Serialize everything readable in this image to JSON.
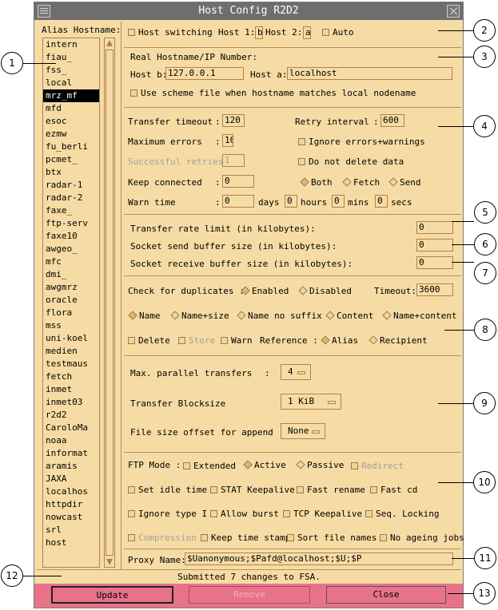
{
  "window": {
    "title": "Host Config R2D2"
  },
  "aliasList": {
    "label": "Alias Hostname:",
    "items": [
      "intern",
      "fiau_",
      "fss_",
      "local",
      "mrz_mf",
      "mfd",
      "esoc",
      "ezmw",
      "fu_berli",
      "pcmet_",
      "btx",
      "radar-1",
      "radar-2",
      "faxe_",
      "ftp-serv",
      "faxe10",
      "awgeo_",
      "mfc",
      "dmi_",
      "awgmrz",
      "oracle",
      "flora",
      "mss",
      "uni-koel",
      "medien",
      "testmaus",
      "fetch",
      "inmet",
      "inmet03",
      "r2d2",
      "CaroloMa",
      "noaa",
      "informat",
      "aramis",
      "JAXA",
      "localhos",
      "httpdir",
      "nowcast",
      "srl",
      "host"
    ],
    "selected": "mrz_mf"
  },
  "hostSwitch": {
    "label": "Host switching",
    "host1Label": "Host 1:",
    "host1": "b",
    "host2Label": "Host 2:",
    "host2": "a",
    "autoLabel": "Auto"
  },
  "realHost": {
    "label": "Real Hostname/IP Number:",
    "hostBLabel": "Host b:",
    "hostB": "127.0.0.1",
    "hostALabel": "Host a:",
    "hostA": "localhost",
    "schemeLabel": "Use scheme file when hostname matches local nodename"
  },
  "transfer": {
    "timeoutLabel": "Transfer timeout",
    "timeout": "120",
    "retryLabel": "Retry interval",
    "retry": "600",
    "maxErrLabel": "Maximum errors",
    "maxErr": "10",
    "ignoreLabel": "Ignore errors+warnings",
    "succLabel": "Successful retries:",
    "succ": "1",
    "noDeleteLabel": "Do not delete data",
    "keepLabel": "Keep connected",
    "keep": "0",
    "bothLabel": "Both",
    "fetchLabel": "Fetch",
    "sendLabel": "Send",
    "warnLabel": "Warn time",
    "days": "0",
    "daysLabel": "days",
    "hours": "0",
    "hoursLabel": "hours",
    "mins": "0",
    "minsLabel": "mins",
    "secs": "0",
    "secsLabel": "secs",
    "colon": ":"
  },
  "rates": {
    "rateLabel": "Transfer rate limit (in kilobytes):",
    "rate": "0",
    "sendBufLabel": "Socket send buffer size (in kilobytes):",
    "sendBuf": "0",
    "recvBufLabel": "Socket receive buffer size (in kilobytes):",
    "recvBuf": "0"
  },
  "dup": {
    "checkLabel": "Check for duplicates :",
    "enabledLabel": "Enabled",
    "disabledLabel": "Disabled",
    "timeoutLabel": "Timeout:",
    "timeout": "3600",
    "nameLabel": "Name",
    "nameSizeLabel": "Name+size",
    "noSuffixLabel": "Name no suffix",
    "contentLabel": "Content",
    "nameContentLabel": "Name+content",
    "deleteLabel": "Delete",
    "storeLabel": "Store",
    "warnLabel": "Warn",
    "refLabel": "Reference :",
    "aliasLabel": "Alias",
    "recipientLabel": "Recipient"
  },
  "parallel": {
    "maxLabel": "Max. parallel transfers",
    "max": "4",
    "blockLabel": "Transfer Blocksize",
    "block": "1 KiB",
    "offsetLabel": "File size offset for append :",
    "offset": "None",
    "colon": ":"
  },
  "ftp": {
    "modeLabel": "FTP Mode :",
    "extendedLabel": "Extended",
    "activeLabel": "Active",
    "passiveLabel": "Passive",
    "redirectLabel": "Redirect",
    "idleLabel": "Set idle time",
    "statLabel": "STAT Keepalive",
    "fastRenameLabel": "Fast rename",
    "fastCdLabel": "Fast cd",
    "ignoreTypeLabel": "Ignore type I",
    "burstLabel": "Allow burst",
    "tcpLabel": "TCP Keepalive",
    "seqLabel": "Seq. Locking",
    "compressionLabel": "Compression",
    "timeStampLabel": "Keep time stamp",
    "sortLabel": "Sort file names",
    "ageingLabel": "No ageing jobs"
  },
  "proxy": {
    "label": "Proxy Name:",
    "value": "$Uanonymous;$Pafd@localhost;$U;$P"
  },
  "status": {
    "text": "Submitted 7 changes to FSA."
  },
  "buttons": {
    "update": "Update",
    "remove": "Remove",
    "close": "Close"
  },
  "callouts": [
    "1",
    "2",
    "3",
    "4",
    "5",
    "6",
    "7",
    "8",
    "9",
    "10",
    "11",
    "12",
    "13"
  ]
}
